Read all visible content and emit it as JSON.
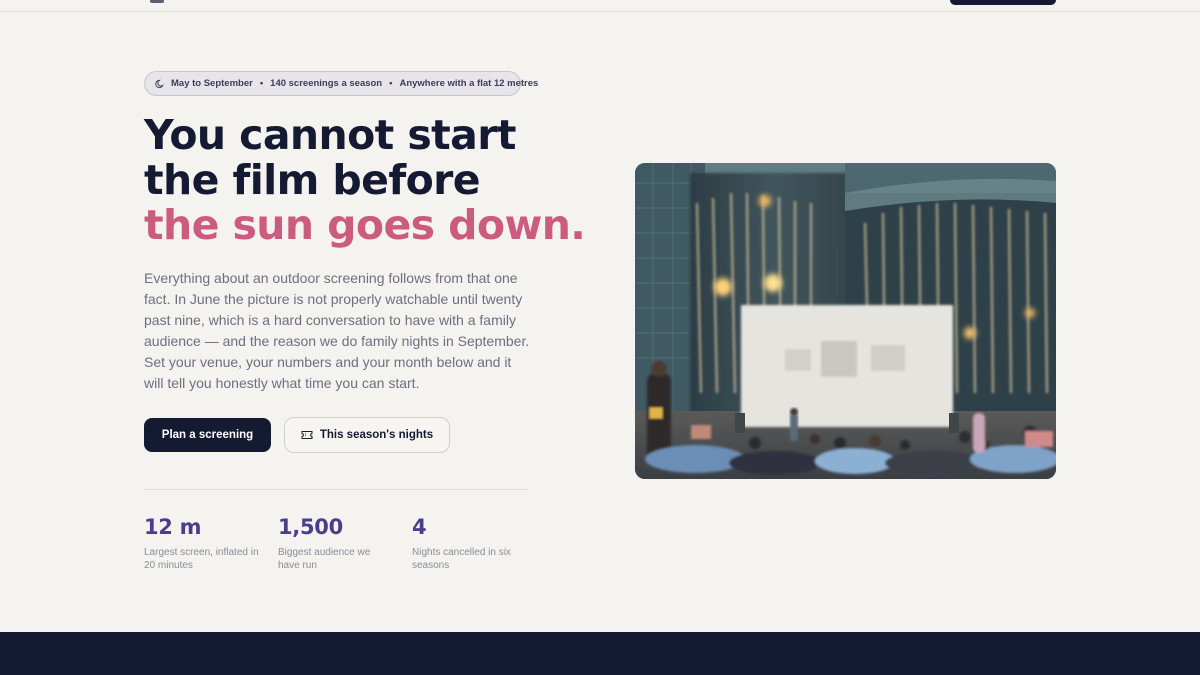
{
  "hero": {
    "pill": {
      "item1": "May to September",
      "item2": "140 screenings a season",
      "item3": "Anywhere with a flat 12 metres",
      "separator": "•"
    },
    "headline_line1": "You cannot start",
    "headline_line2": "the film before",
    "headline_accent": "the sun goes down.",
    "body": "Everything about an outdoor screening follows from that one fact. In June the picture is not properly watchable until twenty past nine, which is a hard conversation to have with a family audience — and the reason we do family nights in September. Set your venue, your numbers and your month below and it will tell you honestly what time you can start.",
    "primary_button": "Plan a screening",
    "secondary_button": "This season's nights"
  },
  "stats": [
    {
      "value": "12 m",
      "label": "Largest screen, inflated in 20 minutes"
    },
    {
      "value": "1,500",
      "label": "Biggest audience we have run"
    },
    {
      "value": "4",
      "label": "Nights cancelled in six seasons"
    }
  ],
  "icons": {
    "pill": "moon-icon",
    "secondary_button": "ticket-icon"
  },
  "colors": {
    "navy": "#151a33",
    "accent_pink": "#cc5c7f",
    "stat_purple": "#4a3e8a",
    "background": "#f5f3ef"
  }
}
